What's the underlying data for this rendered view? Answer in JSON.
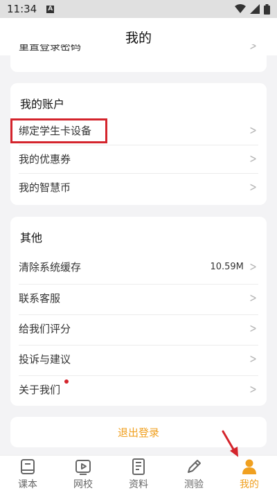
{
  "status_bar": {
    "time": "11:34"
  },
  "header": {
    "title": "我的"
  },
  "partial_row": {
    "label": "重置登录密码"
  },
  "account_section": {
    "title": "我的账户",
    "items": [
      {
        "label": "绑定学生卡设备"
      },
      {
        "label": "我的优惠券"
      },
      {
        "label": "我的智慧币"
      }
    ]
  },
  "other_section": {
    "title": "其他",
    "items": [
      {
        "label": "清除系统缓存",
        "value": "10.59M"
      },
      {
        "label": "联系客服"
      },
      {
        "label": "给我们评分"
      },
      {
        "label": "投诉与建议"
      },
      {
        "label": "关于我们"
      }
    ]
  },
  "logout": {
    "label": "退出登录"
  },
  "tabbar": {
    "tabs": [
      {
        "label": "课本",
        "icon": "book-icon"
      },
      {
        "label": "网校",
        "icon": "video-icon"
      },
      {
        "label": "资料",
        "icon": "document-icon"
      },
      {
        "label": "测验",
        "icon": "pencil-icon"
      },
      {
        "label": "我的",
        "icon": "user-icon",
        "active": true
      }
    ]
  },
  "colors": {
    "accent": "#f0a020",
    "highlight": "#d4242c",
    "background": "#f3f3f5"
  }
}
